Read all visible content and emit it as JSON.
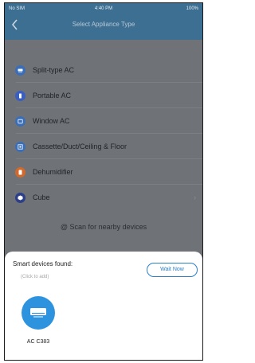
{
  "status_bar": {
    "carrier": "No SIM",
    "time": "4:40 PM",
    "battery": "100%"
  },
  "header": {
    "title": "Select Appliance Type"
  },
  "appliances": [
    {
      "label": "Split-type AC",
      "icon": "split-ac-icon",
      "color": "#3a6fb8"
    },
    {
      "label": "Portable AC",
      "icon": "portable-ac-icon",
      "color": "#3a5fc0"
    },
    {
      "label": "Window AC",
      "icon": "window-ac-icon",
      "color": "#3a6fb8"
    },
    {
      "label": "Cassette/Duct/Ceiling & Floor",
      "icon": "cassette-ac-icon",
      "color": "#3a6fb8"
    },
    {
      "label": "Dehumidifier",
      "icon": "dehumidifier-icon",
      "color": "#d1692c"
    },
    {
      "label": "Cube",
      "icon": "cube-icon",
      "color": "#2e3f88"
    }
  ],
  "scan": {
    "label": "Scan for nearby devices"
  },
  "sheet": {
    "title": "Smart devices found:",
    "hint": "(Click to add)",
    "wait_button": "Wait Now",
    "devices": [
      {
        "name": "AC C383",
        "icon": "ac-unit-icon"
      }
    ]
  },
  "colors": {
    "header": "#3d6f93",
    "accent": "#2d93df",
    "overlay": "#6f7276"
  }
}
